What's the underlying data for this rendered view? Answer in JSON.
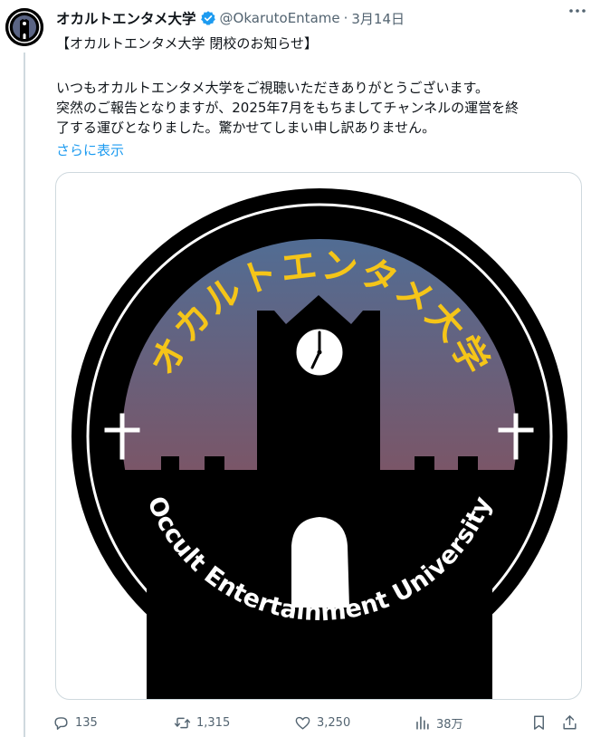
{
  "tweet": {
    "author_name": "オカルトエンタメ大学",
    "handle": "@OkarutoEntame",
    "separator": "·",
    "date": "3月14日",
    "lines": [
      "【オカルトエンタメ大学 閉校のお知らせ】",
      "いつもオカルトエンタメ大学をご視聴いただきありがとうございます。",
      "突然のご報告となりますが、2025年7月をもちましてチャンネルの運営を終",
      "了する運びとなりました。驚かせてしまい申し訳ありません。"
    ],
    "show_more": "さらに表示"
  },
  "logo": {
    "title_jp": "オカルトエンタメ大学",
    "title_en": "Occult Entertainment University",
    "title_color": "#f5c518",
    "sky_top": "#4f6e96",
    "sky_bottom": "#7a5668"
  },
  "actions": {
    "replies": "135",
    "reposts": "1,315",
    "likes": "3,250",
    "views": "38万"
  },
  "colors": {
    "accent": "#1d9bf0",
    "muted": "#536471",
    "border": "#cfd9de"
  }
}
